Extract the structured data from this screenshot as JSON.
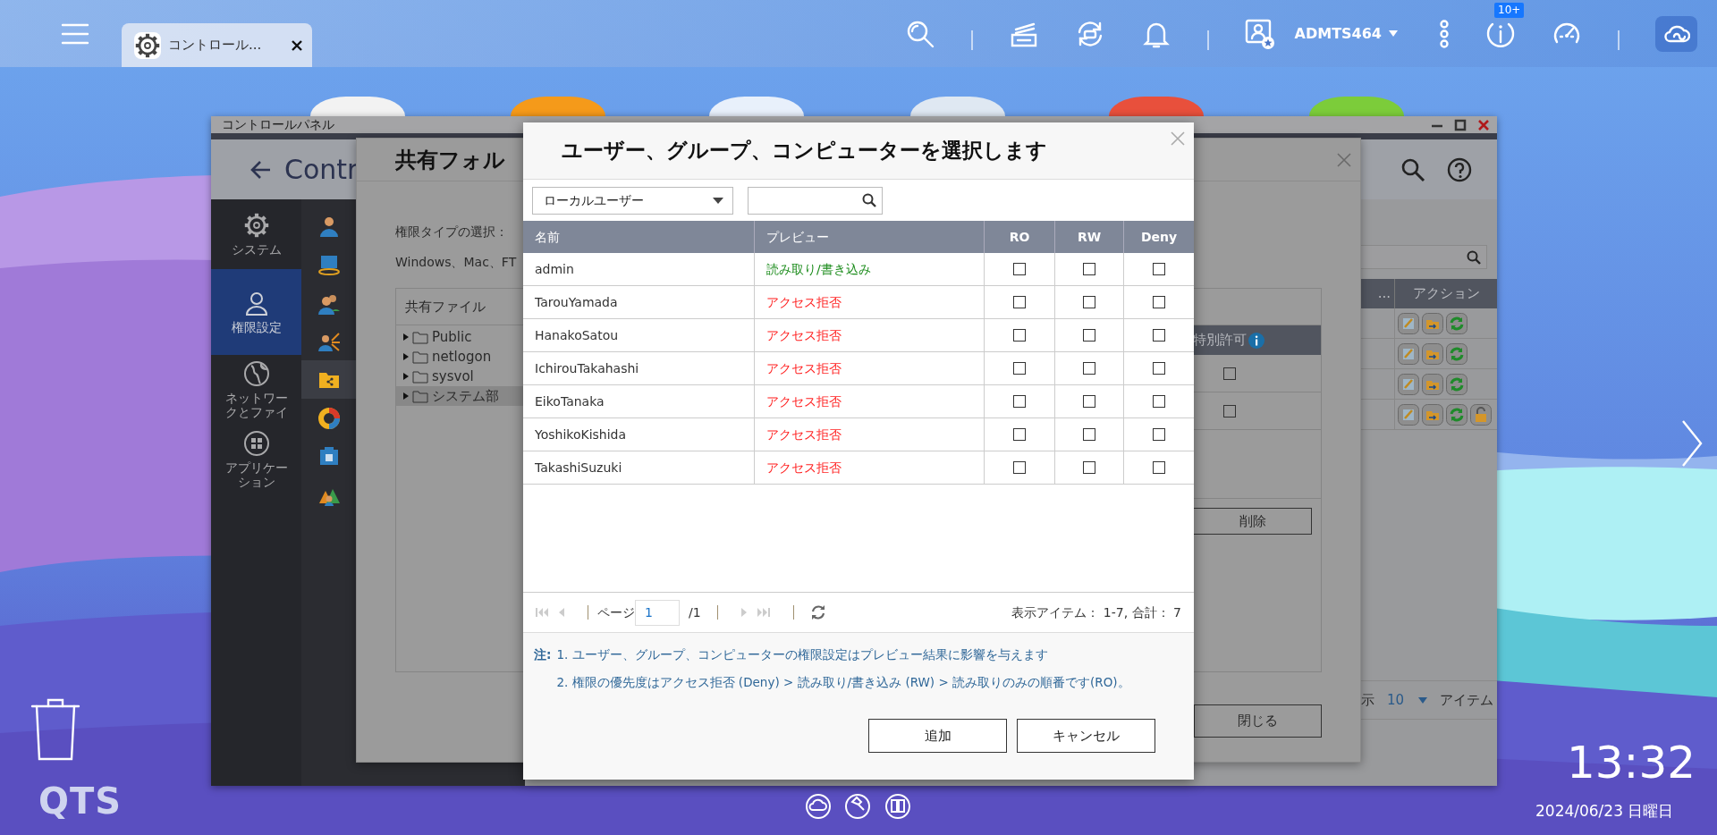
{
  "top_bar": {
    "tab": {
      "label": "コントロール...",
      "selected": true
    },
    "user": "ADMTS464",
    "notifications_badge": "10+"
  },
  "control_panel": {
    "title": "コントロールパネル",
    "header": "Contr",
    "sidebar": [
      {
        "label": "システム",
        "kind": "gear",
        "selected": false
      },
      {
        "label": "権限設定",
        "kind": "person",
        "selected": true
      },
      {
        "label": "ネットワークとファイ",
        "kind": "globe",
        "selected": false
      },
      {
        "label": "アプリケーション",
        "kind": "apps",
        "selected": false
      }
    ],
    "submenu": [
      {
        "kind": "user",
        "selected": false
      },
      {
        "kind": "computer",
        "selected": false
      },
      {
        "kind": "group",
        "selected": false
      },
      {
        "kind": "share",
        "selected": false
      },
      {
        "kind": "folder",
        "selected": true
      },
      {
        "kind": "quota",
        "selected": false
      },
      {
        "kind": "box",
        "selected": false
      },
      {
        "kind": "domain",
        "selected": false
      }
    ],
    "table": {
      "columns": [
        "...",
        "アクション"
      ],
      "rows": [
        {
          "lock": false
        },
        {
          "lock": false
        },
        {
          "lock": false
        },
        {
          "lock": true
        }
      ]
    },
    "footer": {
      "label": "示",
      "per_page": "10",
      "suffix": "アイテム"
    }
  },
  "shared_folder_dialog": {
    "title": "共有フォル",
    "permission_type_label": "権限タイプの選択：",
    "platforms": "Windows、Mac、FT",
    "tree_header": "共有ファイル",
    "folders": [
      {
        "name": "Public",
        "selected": false
      },
      {
        "name": "netlogon",
        "selected": false
      },
      {
        "name": "sysvol",
        "selected": false
      },
      {
        "name": "システム部",
        "selected": true
      }
    ],
    "special_permission": {
      "header": "特別許可",
      "rows": [
        {
          "checked": false
        },
        {
          "checked": false
        }
      ]
    },
    "delete_button": "削除",
    "close_button": "閉じる"
  },
  "select_dialog": {
    "title": "ユーザー、グループ、コンピューターを選択します",
    "scope": "ローカルユーザー",
    "columns": [
      "名前",
      "プレビュー",
      "RO",
      "RW",
      "Deny"
    ],
    "rows": [
      {
        "name": "admin",
        "preview": "読み取り/書き込み",
        "kind": "allow",
        "ro": false,
        "rw": false,
        "deny": false
      },
      {
        "name": "TarouYamada",
        "preview": "アクセス拒否",
        "kind": "deny",
        "ro": false,
        "rw": false,
        "deny": false
      },
      {
        "name": "HanakoSatou",
        "preview": "アクセス拒否",
        "kind": "deny",
        "ro": false,
        "rw": false,
        "deny": false
      },
      {
        "name": "IchirouTakahashi",
        "preview": "アクセス拒否",
        "kind": "deny",
        "ro": false,
        "rw": false,
        "deny": false
      },
      {
        "name": "EikoTanaka",
        "preview": "アクセス拒否",
        "kind": "deny",
        "ro": false,
        "rw": false,
        "deny": false
      },
      {
        "name": "YoshikoKishida",
        "preview": "アクセス拒否",
        "kind": "deny",
        "ro": false,
        "rw": false,
        "deny": false
      },
      {
        "name": "TakashiSuzuki",
        "preview": "アクセス拒否",
        "kind": "deny",
        "ro": false,
        "rw": false,
        "deny": false
      }
    ],
    "pager": {
      "page_label": "ページ",
      "page": "1",
      "total_pages": "/1",
      "summary": "表示アイテム： 1-7, 合計： 7"
    },
    "notes": {
      "label": "注:",
      "items": [
        "1. ユーザー、グループ、コンピューターの権限設定はプレビュー結果に影響を与えます",
        "2. 権限の優先度はアクセス拒否 (Deny) > 読み取り/書き込み (RW) > 読み取りのみの順番です(RO)。"
      ]
    },
    "buttons": [
      "追加",
      "キャンセル"
    ]
  },
  "desktop": {
    "logo": "QTS",
    "clock": "13:32",
    "date": "2024/06/23 日曜日"
  }
}
